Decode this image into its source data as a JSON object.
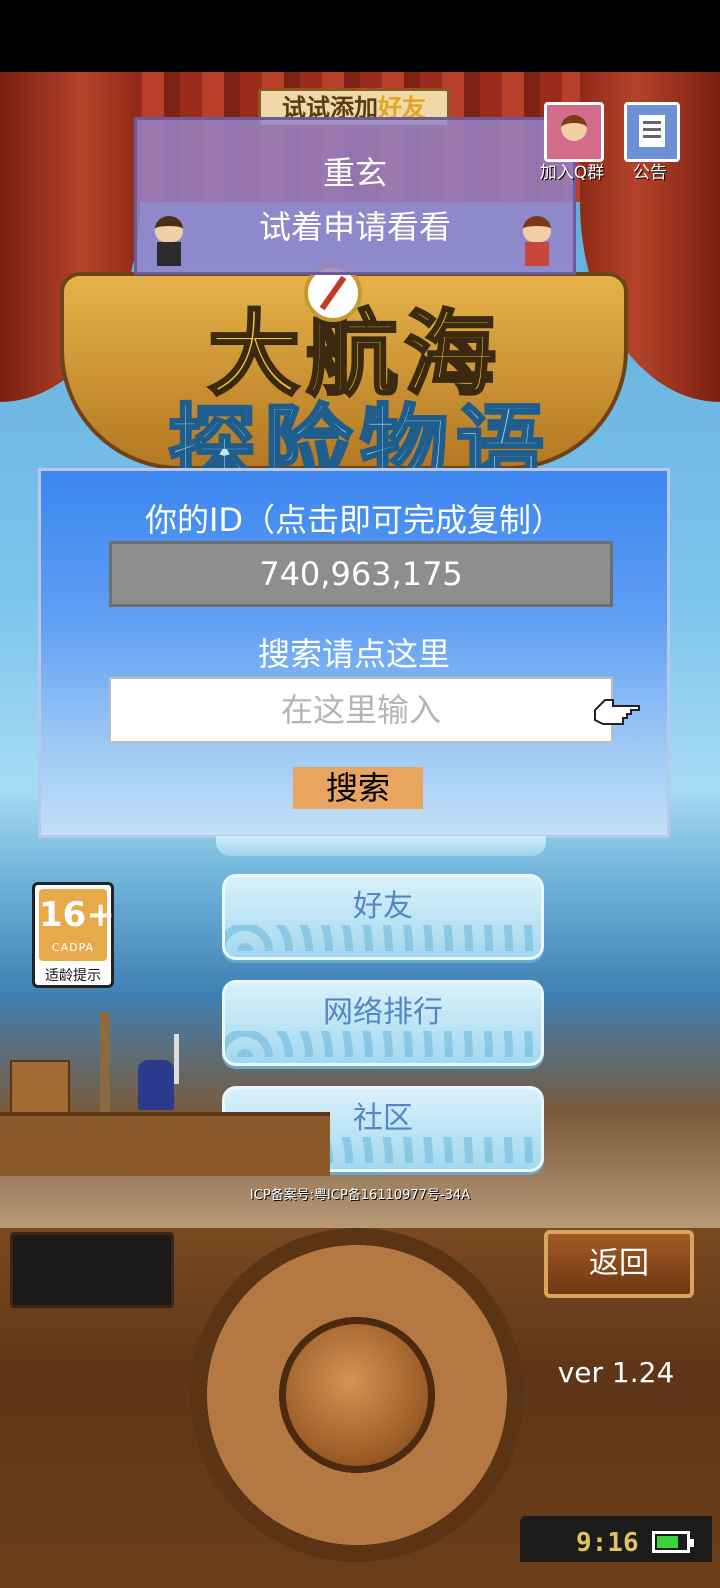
{
  "top_banner": {
    "text_plain": "试试添加",
    "text_highlight": "好友"
  },
  "hint_box": {
    "title": "重玄",
    "subtitle": "试着申请看看"
  },
  "corner_buttons": {
    "qq_group_label": "加入Q群",
    "notice_label": "公告"
  },
  "logo": {
    "line1": "大航海",
    "line2": "探险物语"
  },
  "id_panel": {
    "title": "你的ID（点击即可完成复制）",
    "id_value": "740,963,175",
    "search_title": "搜索请点这里",
    "search_placeholder": "在这里输入",
    "search_button": "搜索"
  },
  "menu": {
    "items": [
      {
        "label": "好友"
      },
      {
        "label": "网络排行"
      },
      {
        "label": "社区"
      }
    ]
  },
  "age_rating": {
    "number": "16+",
    "org": "CADPA",
    "label": "适龄提示"
  },
  "icp": "ICP备案号:粤ICP备16110977号-34A",
  "controller": {
    "back_label": "返回",
    "version": "ver 1.24",
    "clock": "9:16",
    "battery_level": 0.75
  }
}
